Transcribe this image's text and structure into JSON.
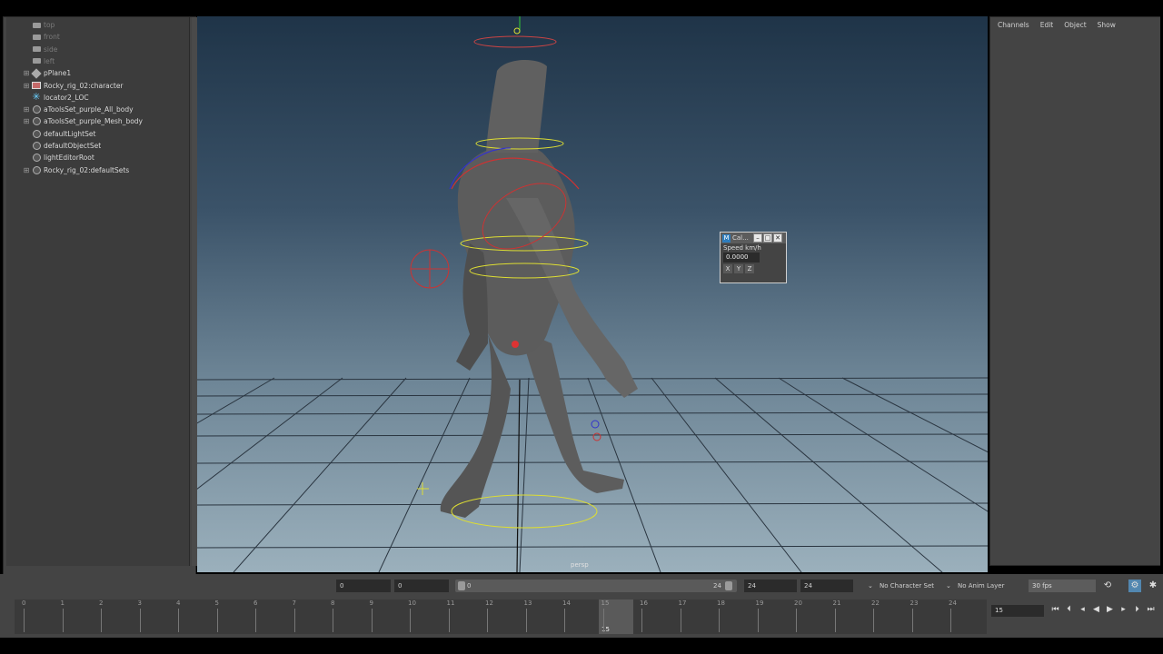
{
  "outliner": {
    "items": [
      {
        "label": "top",
        "icon": "camera-icon",
        "expandable": false,
        "dim": true
      },
      {
        "label": "front",
        "icon": "camera-icon",
        "expandable": false,
        "dim": true
      },
      {
        "label": "side",
        "icon": "camera-icon",
        "expandable": false,
        "dim": true
      },
      {
        "label": "left",
        "icon": "camera-icon",
        "expandable": false,
        "dim": true
      },
      {
        "label": "pPlane1",
        "icon": "mesh-icon",
        "expandable": true,
        "dim": false
      },
      {
        "label": "Rocky_rig_02:character",
        "icon": "reference-icon",
        "expandable": true,
        "dim": false
      },
      {
        "label": "locator2_LOC",
        "icon": "locator-icon",
        "expandable": false,
        "dim": false
      },
      {
        "label": "aToolsSet_purple_All_body",
        "icon": "set-icon",
        "expandable": true,
        "dim": false
      },
      {
        "label": "aToolsSet_purple_Mesh_body",
        "icon": "set-icon",
        "expandable": true,
        "dim": false
      },
      {
        "label": "defaultLightSet",
        "icon": "set-icon",
        "expandable": false,
        "dim": false
      },
      {
        "label": "defaultObjectSet",
        "icon": "set-icon",
        "expandable": false,
        "dim": false
      },
      {
        "label": "lightEditorRoot",
        "icon": "set-icon",
        "expandable": false,
        "dim": false
      },
      {
        "label": "Rocky_rig_02:defaultSets",
        "icon": "set-icon",
        "expandable": true,
        "dim": false
      }
    ]
  },
  "viewport": {
    "camera_label": "persp"
  },
  "calc_window": {
    "title": "Cal...",
    "speed_label": "Speed km/h",
    "value": "0.0000",
    "axes": [
      "X",
      "Y",
      "Z"
    ]
  },
  "channel_box": {
    "menu": [
      "Channels",
      "Edit",
      "Object",
      "Show"
    ]
  },
  "range_slider": {
    "start_field": "0",
    "anim_start_field": "0",
    "range_start": "0",
    "range_end": "24",
    "end_field": "24",
    "anim_end_field": "24",
    "character_set": "No Character Set",
    "anim_layer": "No Anim Layer",
    "fps": "30 fps"
  },
  "time_slider": {
    "ticks": [
      "0",
      "1",
      "2",
      "3",
      "4",
      "5",
      "6",
      "7",
      "8",
      "9",
      "10",
      "11",
      "12",
      "13",
      "14",
      "15",
      "16",
      "17",
      "18",
      "19",
      "20",
      "21",
      "22",
      "23",
      "24"
    ],
    "current_frame": "15",
    "current_frame_field": "15"
  },
  "colors": {
    "accent": "#5287b0",
    "panel": "#444444",
    "viewport_top": "#1f3448",
    "viewport_bottom": "#9bb0bc"
  }
}
